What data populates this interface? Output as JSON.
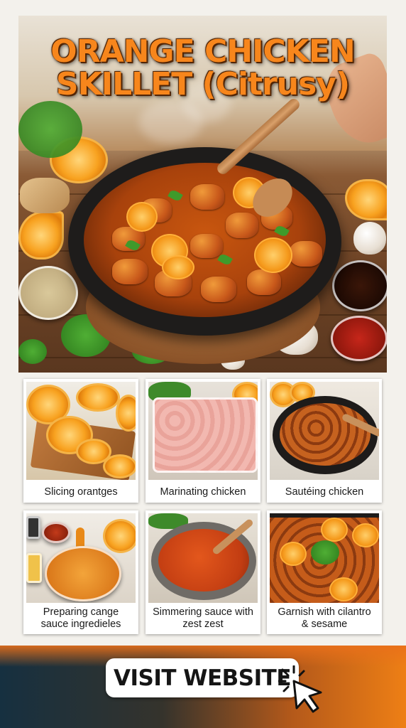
{
  "hero": {
    "title_line1": "ORANGE CHICKEN",
    "title_line2": "SKILLET (Citrusy)"
  },
  "steps": [
    {
      "caption": "Slicing orantges"
    },
    {
      "caption": "Marinating chicken"
    },
    {
      "caption": "Sautéing chicken"
    },
    {
      "caption": "Preparing cange sauce ingredieles"
    },
    {
      "caption": "Simmering sauce with zest zest"
    },
    {
      "caption": "Garnish with cilantro & sesame"
    }
  ],
  "cta": {
    "label": "VISIT WEBSITE",
    "icon": "cursor-click-icon"
  },
  "colors": {
    "title_orange": "#f7861c",
    "footer_dark": "#163040",
    "footer_orange": "#ee7f15"
  }
}
